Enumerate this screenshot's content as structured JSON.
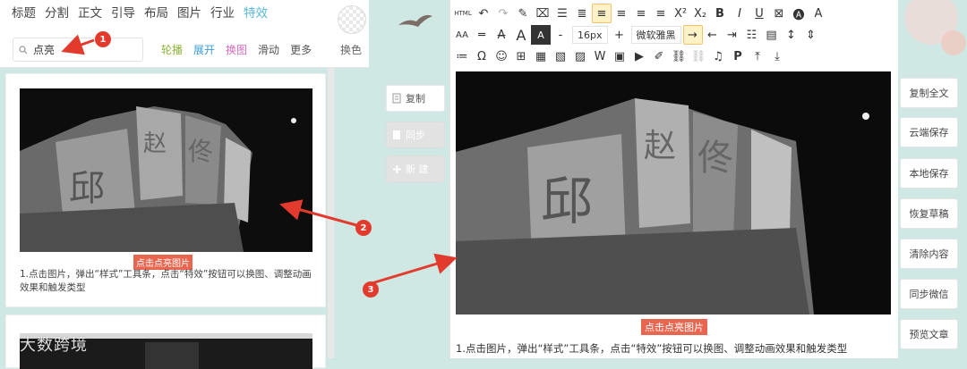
{
  "nav": {
    "tabs": [
      "标题",
      "分割",
      "正文",
      "引导",
      "布局",
      "图片",
      "行业",
      "特效"
    ],
    "active_tab_index": 7,
    "search": {
      "value": "点亮"
    },
    "filters": [
      {
        "label": "轮播",
        "color": "#8fb33b"
      },
      {
        "label": "展开",
        "color": "#3a9bd5"
      },
      {
        "label": "换图",
        "color": "#d46bbf"
      },
      {
        "label": "滑动",
        "color": "#555555"
      },
      {
        "label": "更多",
        "color": "#555555"
      }
    ],
    "change_skin": "换色"
  },
  "left_content": {
    "caption": "点击点亮图片",
    "description": "1.点击图片，弹出“样式”工具条，点击“特效”按钮可以换图、调整动画效果和触发类型"
  },
  "mid_buttons": {
    "copy": "复制",
    "sync": "同步",
    "new": "新 建"
  },
  "toolbar": {
    "html_label": "HTML",
    "font_size": "16px",
    "font_family": "微软雅黑",
    "bold": "B",
    "italic": "I",
    "underline": "U",
    "sup": "X²",
    "sub": "X₂",
    "letter_a": "A",
    "omega": "Ω",
    "paragraph": "P"
  },
  "editor": {
    "caption": "点击点亮图片",
    "description": "1.点击图片，弹出“样式”工具条，点击“特效”按钮可以换图、调整动画效果和触发类型"
  },
  "sidebar": [
    "复制全文",
    "云端保存",
    "本地保存",
    "恢复草稿",
    "清除内容",
    "同步微信",
    "预览文章"
  ],
  "annotations": [
    "1",
    "2",
    "3"
  ],
  "watermark": "大数跨境",
  "colors": {
    "accent_blue": "#58b7d6",
    "annotation_red": "#e23b2e",
    "caption_bg": "#e8664f"
  }
}
